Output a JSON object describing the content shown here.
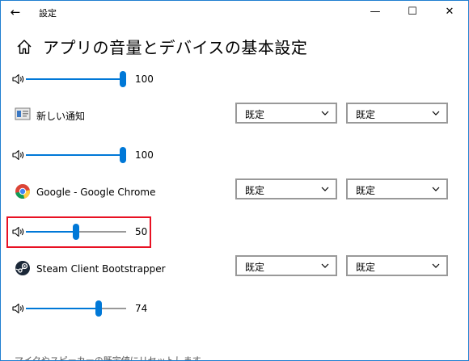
{
  "window": {
    "app_title": "設定",
    "back_icon": "back-arrow-icon",
    "minimize_glyph": "—",
    "maximize_glyph": "☐",
    "close_glyph": "✕"
  },
  "page": {
    "title": "アプリの音量とデバイスの基本設定"
  },
  "rows": [
    {
      "volume": 100,
      "volume_label": "100"
    },
    {
      "app_name": "新しい通知",
      "icon": "notification-app-icon",
      "output": "既定",
      "input": "既定",
      "volume": 100,
      "volume_label": "100"
    },
    {
      "app_name": "Google - Google Chrome",
      "icon": "chrome-icon",
      "output": "既定",
      "input": "既定",
      "volume": 50,
      "volume_label": "50"
    },
    {
      "app_name": "Steam Client Bootstrapper",
      "icon": "steam-icon",
      "output": "既定",
      "input": "既定",
      "volume": 74,
      "volume_label": "74"
    }
  ],
  "footer": {
    "text": "マイクやスピーカーの既定値にリセットします"
  },
  "colors": {
    "accent": "#0078d7",
    "highlight": "#e81123",
    "window_border": "#1f7fd1"
  }
}
